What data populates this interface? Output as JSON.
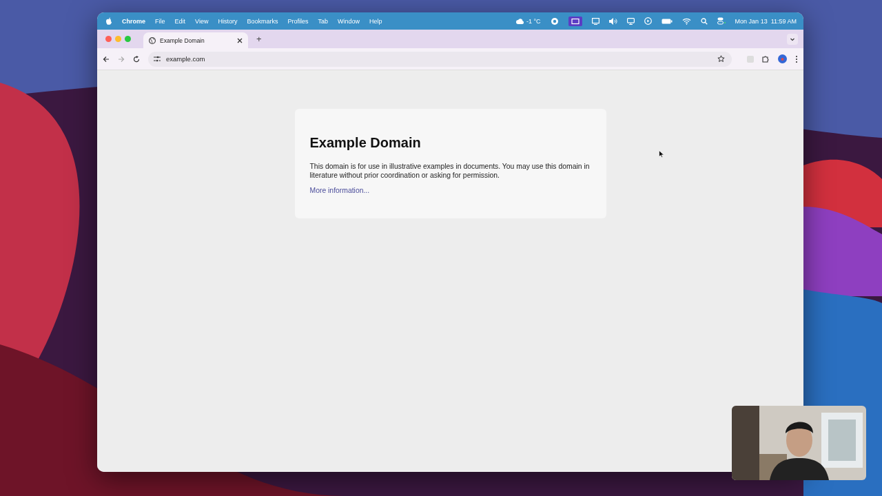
{
  "menu_bar": {
    "app_name": "Chrome",
    "menus": [
      "File",
      "Edit",
      "View",
      "History",
      "Bookmarks",
      "Profiles",
      "Tab",
      "Window",
      "Help"
    ],
    "weather": "-1 °C",
    "clock": "Mon Jan 13  11:59 AM"
  },
  "tabs": [
    {
      "title": "Example Domain",
      "selected": true
    }
  ],
  "new_tab": "+",
  "address_bar": {
    "url": "example.com"
  },
  "page": {
    "heading": "Example Domain",
    "body": "This domain is for use in illustrative examples in documents. You may use this domain in literature without prior coordination or asking for permission.",
    "link": "More information..."
  }
}
